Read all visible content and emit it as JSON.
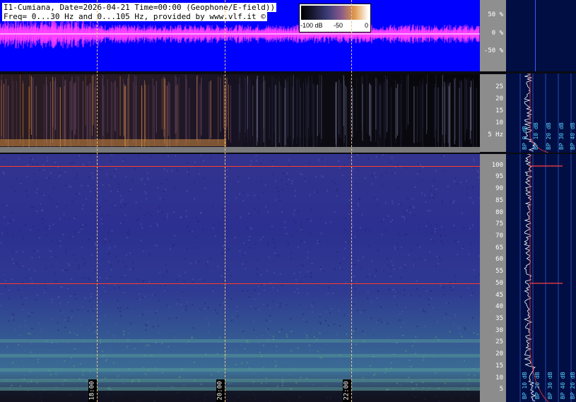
{
  "header": {
    "line1": "I1-Cumiana, Date=2026-04-21 Time=00:00 (Geophone/E-field))",
    "line2": "Freq= 0...30 Hz and 0...105 Hz, provided by www.vlf.it ©"
  },
  "colorbar": {
    "min_label": "-100 dB",
    "mid_label": "-50",
    "max_label": "0"
  },
  "wave_axis": [
    "50 %",
    "0 %",
    "-50 %"
  ],
  "freq_axis_top": [
    "25",
    "20",
    "15",
    "10",
    "5 Hz"
  ],
  "freq_axis_bottom": [
    "100",
    "95",
    "90",
    "85",
    "80",
    "75",
    "70",
    "65",
    "60",
    "55",
    "50",
    "45",
    "40",
    "35",
    "30",
    "25",
    "20",
    "15",
    "10",
    "5"
  ],
  "time_labels": [
    "18:00",
    "20:00",
    "22:00"
  ],
  "profile_labels": [
    "BP 0 dB",
    "BP 10 dB",
    "BP 20 dB",
    "BP 30 dB",
    "BP 40 dB"
  ],
  "profile_labels_bottom": [
    "BP 10 dB",
    "BP 20 dB",
    "BP 30 dB",
    "BP 40 dB",
    "BP 20 dB"
  ],
  "colors": {
    "wave_bg": "#0000ff",
    "wave_trace": "#ff40ff",
    "line50": "#ff3a2a",
    "profile_bg": "#000e44"
  }
}
